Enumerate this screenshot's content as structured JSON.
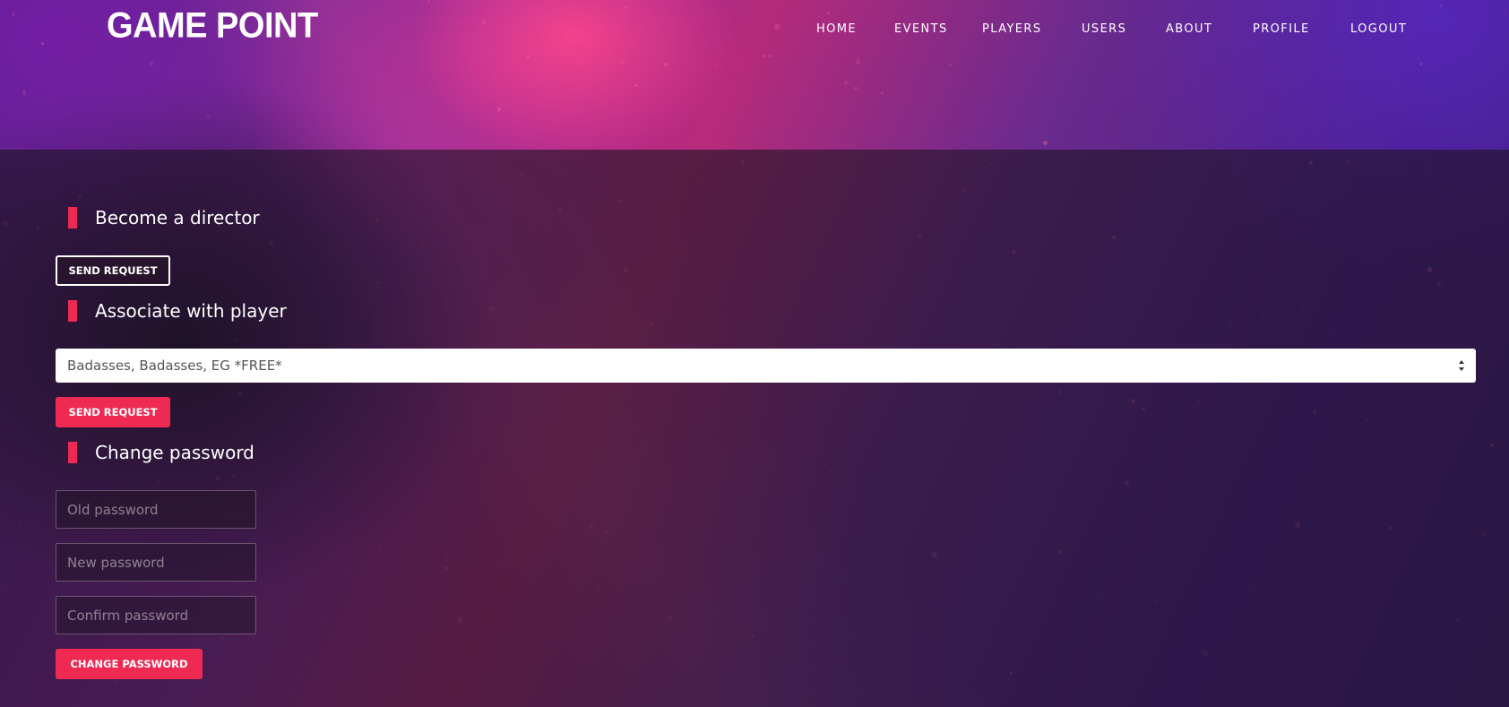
{
  "brand": {
    "logo": "GAME POINT"
  },
  "nav": {
    "items": [
      {
        "label": "HOME"
      },
      {
        "label": "EVENTS"
      },
      {
        "label": "PLAYERS"
      },
      {
        "label": "USERS"
      },
      {
        "label": "ABOUT"
      },
      {
        "label": "PROFILE"
      },
      {
        "label": "LOGOUT"
      }
    ]
  },
  "director": {
    "title": "Become a director",
    "button_label": "SEND REQUEST"
  },
  "associate": {
    "title": "Associate with player",
    "selected_player": "Badasses, Badasses, EG *FREE*",
    "button_label": "SEND REQUEST"
  },
  "password": {
    "title": "Change password",
    "old_placeholder": "Old password",
    "new_placeholder": "New password",
    "confirm_placeholder": "Confirm password",
    "button_label": "CHANGE PASSWORD"
  },
  "colors": {
    "accent": "#ee2a52",
    "overlay": "#1e1423"
  }
}
